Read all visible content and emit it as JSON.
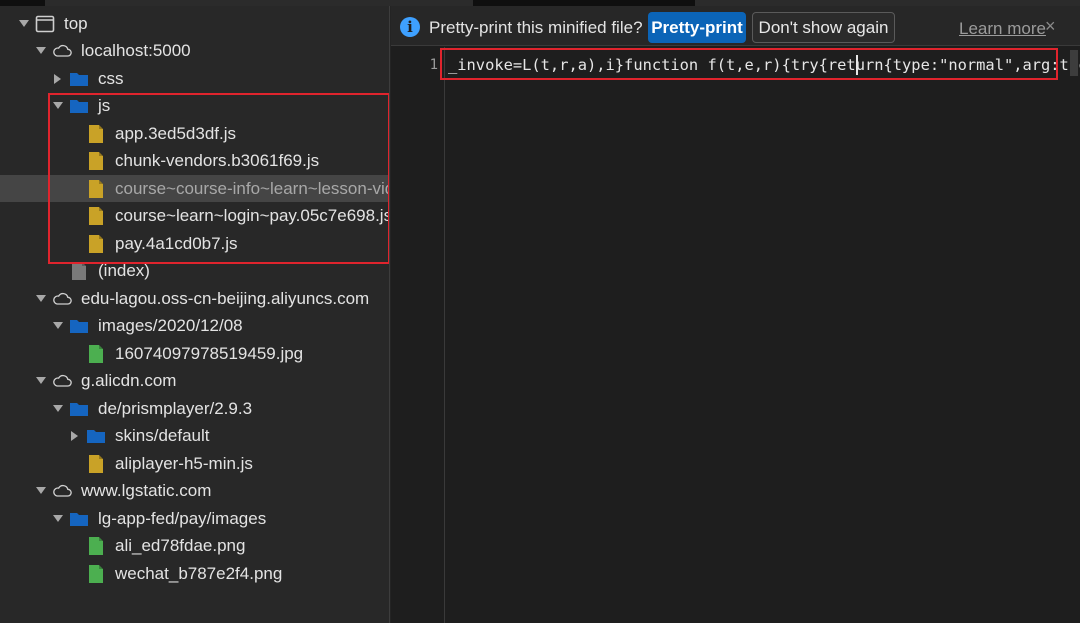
{
  "colors": {
    "folder": "#1565c0",
    "js_file": "#c9a227",
    "image_file": "#4caf50",
    "doc_file": "#7a7a7a",
    "highlight_border": "#e0242d",
    "primary_button": "#0b64b7"
  },
  "tree": [
    {
      "label": "top",
      "icon": "frame-icon",
      "expanded": true
    },
    {
      "label": "localhost:5000",
      "icon": "cloud-icon",
      "expanded": true
    },
    {
      "label": "css",
      "icon": "folder-icon",
      "expanded": false
    },
    {
      "label": "js",
      "icon": "folder-icon",
      "expanded": true
    },
    {
      "label": "app.3ed5d3df.js",
      "icon": "script-file-icon"
    },
    {
      "label": "chunk-vendors.b3061f69.js",
      "icon": "script-file-icon"
    },
    {
      "label": "course~course-info~learn~lesson-vid",
      "icon": "script-file-icon",
      "selected": true
    },
    {
      "label": "course~learn~login~pay.05c7e698.js",
      "icon": "script-file-icon"
    },
    {
      "label": "pay.4a1cd0b7.js",
      "icon": "script-file-icon"
    },
    {
      "label": "(index)",
      "icon": "document-file-icon"
    },
    {
      "label": "edu-lagou.oss-cn-beijing.aliyuncs.com",
      "icon": "cloud-icon",
      "expanded": true
    },
    {
      "label": "images/2020/12/08",
      "icon": "folder-icon",
      "expanded": true
    },
    {
      "label": "16074097978519459.jpg",
      "icon": "image-file-icon"
    },
    {
      "label": "g.alicdn.com",
      "icon": "cloud-icon",
      "expanded": true
    },
    {
      "label": "de/prismplayer/2.9.3",
      "icon": "folder-icon",
      "expanded": true
    },
    {
      "label": "skins/default",
      "icon": "folder-icon",
      "expanded": false
    },
    {
      "label": "aliplayer-h5-min.js",
      "icon": "script-file-icon"
    },
    {
      "label": "www.lgstatic.com",
      "icon": "cloud-icon",
      "expanded": true
    },
    {
      "label": "lg-app-fed/pay/images",
      "icon": "folder-icon",
      "expanded": true
    },
    {
      "label": "ali_ed78fdae.png",
      "icon": "image-file-icon"
    },
    {
      "label": "wechat_b787e2f4.png",
      "icon": "image-file-icon"
    }
  ],
  "infobar": {
    "icon": "info-icon",
    "icon_glyph": "i",
    "message": "Pretty-print this minified file?",
    "pretty_print_label": "Pretty-print",
    "dont_show_label": "Don't show again",
    "learn_more_label": "Learn more",
    "close_glyph": "×"
  },
  "editor": {
    "line_number": "1",
    "code_line": "_invoke=L(t,r,a),i}function f(t,e,r){try{return{type:\"normal\",arg:t.ca"
  }
}
